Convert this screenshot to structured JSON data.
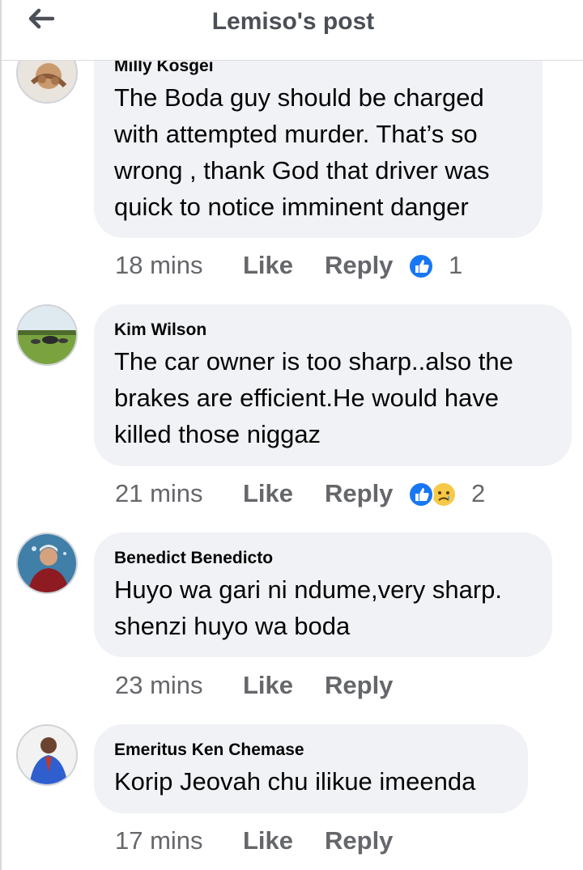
{
  "header": {
    "title": "Lemiso's post",
    "back_icon": "arrow-left-icon"
  },
  "colors": {
    "like_blue": "#1877f2",
    "bubble": "#f0f2f5",
    "meta": "#65676b"
  },
  "comments": [
    {
      "author": "Milly Kosgei",
      "lines": [
        "The Boda guy should be charged",
        "with attempted murder. That’s so",
        "wrong , thank God that driver was",
        "quick to notice imminent danger"
      ],
      "time": "18 mins",
      "like": "Like",
      "reply": "Reply",
      "reactions": [
        "like"
      ],
      "reaction_count": "1"
    },
    {
      "author": "Kim Wilson",
      "lines": [
        "The car owner is too sharp..also the",
        "brakes are efficient.He would have",
        "killed those niggaz"
      ],
      "time": "21 mins",
      "like": "Like",
      "reply": "Reply",
      "reactions": [
        "like",
        "sad"
      ],
      "reaction_count": "2"
    },
    {
      "author": "Benedict Benedicto",
      "lines": [
        "Huyo wa gari ni ndume,very sharp.",
        "shenzi huyo wa boda"
      ],
      "time": "23 mins",
      "like": "Like",
      "reply": "Reply"
    },
    {
      "author": "Emeritus Ken Chemase",
      "lines": [
        "Korip Jeovah chu ilikue imeenda"
      ],
      "time": "17 mins",
      "like": "Like",
      "reply": "Reply"
    }
  ]
}
